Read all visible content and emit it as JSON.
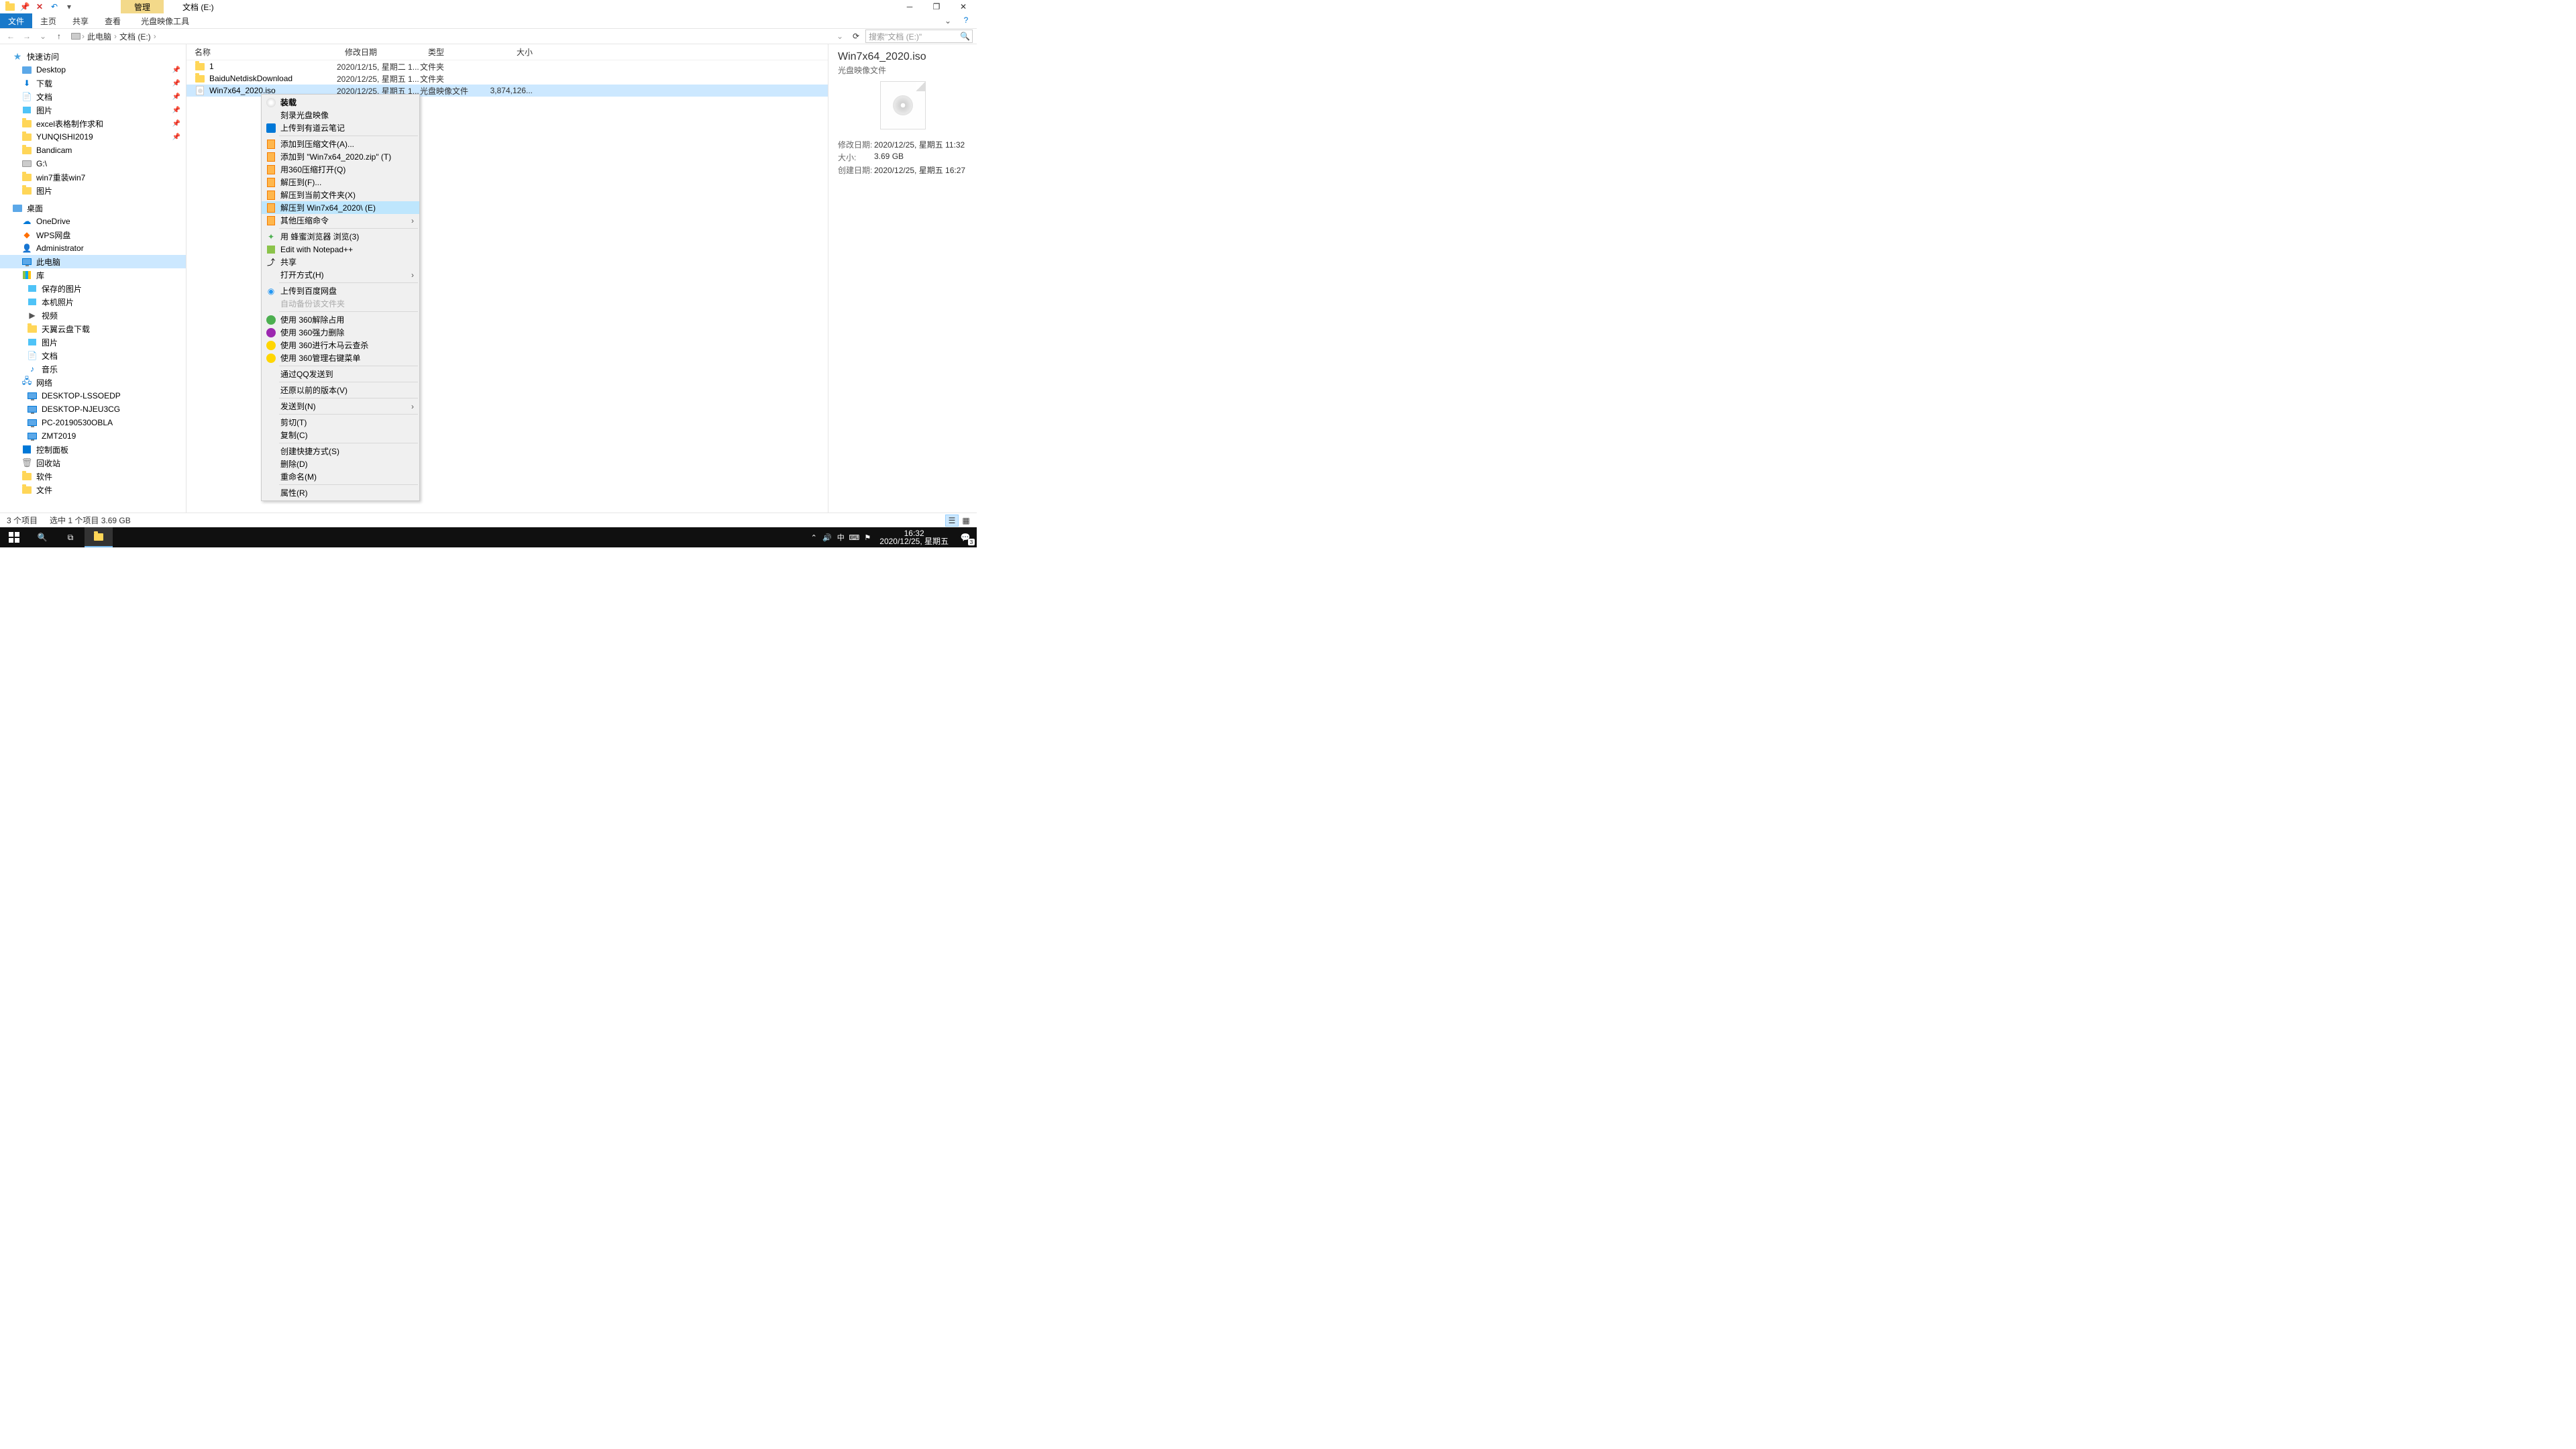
{
  "title_bar": {
    "context_tab": "管理",
    "title": "文档 (E:)"
  },
  "ribbon": {
    "file": "文件",
    "home": "主页",
    "share": "共享",
    "view": "查看",
    "context": "光盘映像工具"
  },
  "address": {
    "crumbs": [
      "此电脑",
      "文档 (E:)"
    ],
    "search_placeholder": "搜索\"文档 (E:)\""
  },
  "nav": {
    "quick_access": "快速访问",
    "desktop": "Desktop",
    "downloads": "下载",
    "documents": "文档",
    "pictures": "图片",
    "excel": "excel表格制作求和",
    "yunqishi": "YUNQISHI2019",
    "bandicam": "Bandicam",
    "gdrive": "G:\\",
    "win7re": "win7重装win7",
    "pictures2": "图片",
    "desktop_root": "桌面",
    "onedrive": "OneDrive",
    "wps": "WPS网盘",
    "admin": "Administrator",
    "thispc": "此电脑",
    "library": "库",
    "saved_pics": "保存的图片",
    "local_pics": "本机照片",
    "videos": "视频",
    "tianyi": "天翼云盘下载",
    "pics3": "图片",
    "docs2": "文档",
    "music": "音乐",
    "network": "网络",
    "pc1": "DESKTOP-LSSOEDP",
    "pc2": "DESKTOP-NJEU3CG",
    "pc3": "PC-20190530OBLA",
    "pc4": "ZMT2019",
    "control": "控制面板",
    "recycle": "回收站",
    "software": "软件",
    "files": "文件"
  },
  "columns": {
    "name": "名称",
    "date": "修改日期",
    "type": "类型",
    "size": "大小"
  },
  "rows": [
    {
      "name": "1",
      "date": "2020/12/15, 星期二 1...",
      "type": "文件夹",
      "size": ""
    },
    {
      "name": "BaiduNetdiskDownload",
      "date": "2020/12/25, 星期五 1...",
      "type": "文件夹",
      "size": ""
    },
    {
      "name": "Win7x64_2020.iso",
      "date": "2020/12/25, 星期五 1...",
      "type": "光盘映像文件",
      "size": "3,874,126..."
    }
  ],
  "ctx": {
    "mount": "装载",
    "burn": "刻录光盘映像",
    "youdao": "上传到有道云笔记",
    "add_archive": "添加到压缩文件(A)...",
    "add_zip": "添加到 \"Win7x64_2020.zip\" (T)",
    "open_360": "用360压缩打开(Q)",
    "extract_to": "解压到(F)...",
    "extract_here": "解压到当前文件夹(X)",
    "extract_named": "解压到 Win7x64_2020\\ (E)",
    "other_compress": "其他压缩命令",
    "bee": "用 蜂蜜浏览器 浏览(3)",
    "notepad": "Edit with Notepad++",
    "share": "共享",
    "open_with": "打开方式(H)",
    "baidu": "上传到百度网盘",
    "auto_backup": "自动备份该文件夹",
    "u360_unlock": "使用 360解除占用",
    "u360_del": "使用 360强力删除",
    "u360_scan": "使用 360进行木马云查杀",
    "u360_menu": "使用 360管理右键菜单",
    "qq": "通过QQ发送到",
    "restore": "还原以前的版本(V)",
    "send_to": "发送到(N)",
    "cut": "剪切(T)",
    "copy": "复制(C)",
    "shortcut": "创建快捷方式(S)",
    "delete": "删除(D)",
    "rename": "重命名(M)",
    "properties": "属性(R)"
  },
  "details": {
    "title": "Win7x64_2020.iso",
    "type": "光盘映像文件",
    "mod_k": "修改日期:",
    "mod_v": "2020/12/25, 星期五 11:32",
    "size_k": "大小:",
    "size_v": "3.69 GB",
    "create_k": "创建日期:",
    "create_v": "2020/12/25, 星期五 16:27"
  },
  "status": {
    "count": "3 个项目",
    "sel": "选中 1 个项目  3.69 GB"
  },
  "taskbar": {
    "time": "16:32",
    "date": "2020/12/25, 星期五",
    "ime": "中",
    "notif_count": "3"
  }
}
